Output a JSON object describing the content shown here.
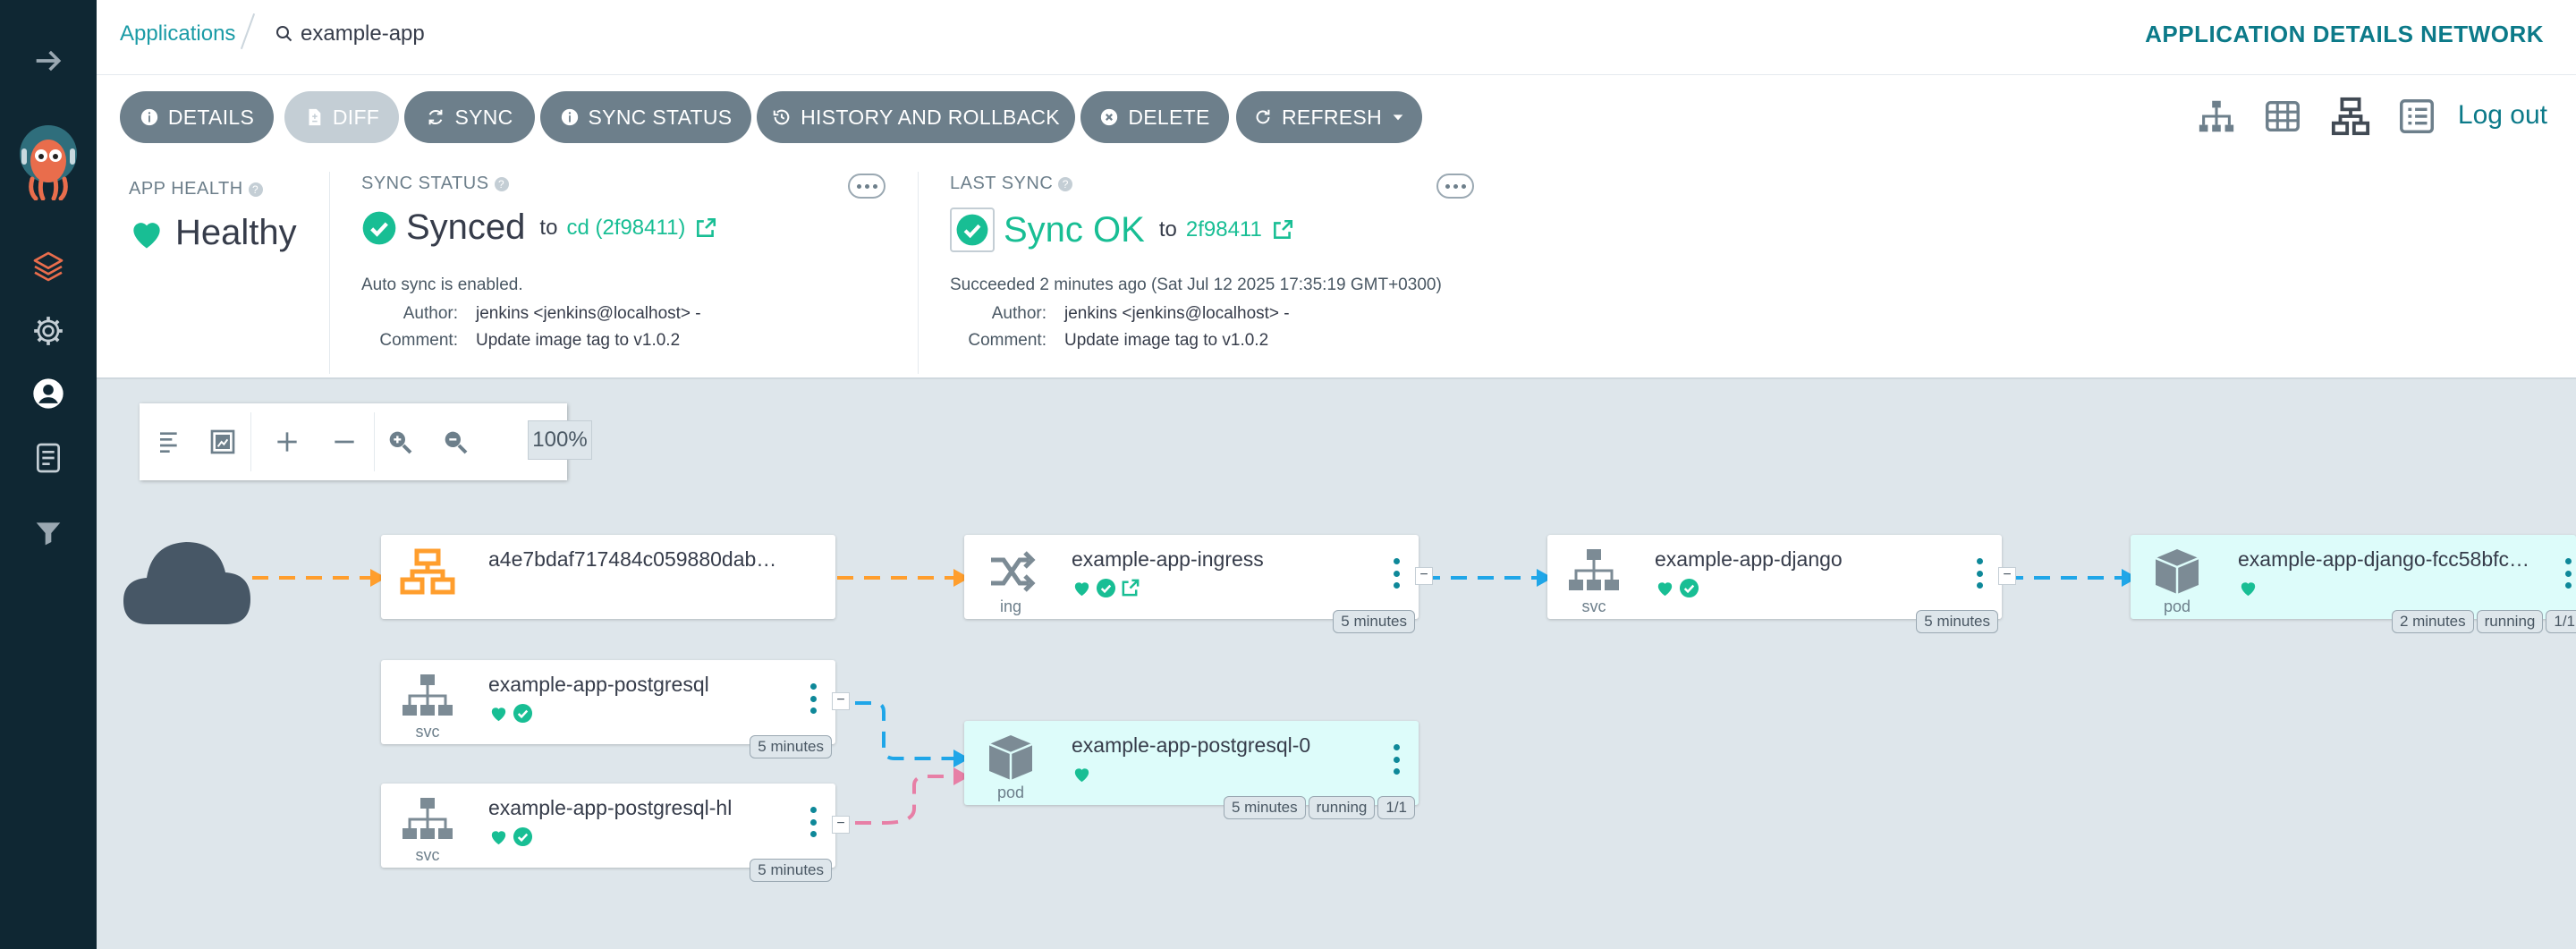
{
  "breadcrumb": {
    "applications": "Applications",
    "current": "example-app"
  },
  "page_title": "APPLICATION DETAILS NETWORK",
  "toolbar": {
    "details": "DETAILS",
    "diff": "DIFF",
    "sync": "SYNC",
    "sync_status": "SYNC STATUS",
    "history": "HISTORY AND ROLLBACK",
    "delete": "DELETE",
    "refresh": "REFRESH",
    "logout": "Log out"
  },
  "app_health": {
    "label": "APP HEALTH",
    "value": "Healthy",
    "help": "?"
  },
  "sync_status": {
    "label": "SYNC STATUS",
    "help": "?",
    "value": "Synced",
    "to": "to",
    "revision": "cd (2f98411)",
    "auto_sync": "Auto sync is enabled.",
    "author_key": "Author:",
    "author": "jenkins <jenkins@localhost> -",
    "comment_key": "Comment:",
    "comment": "Update image tag to v1.0.2"
  },
  "last_sync": {
    "label": "LAST SYNC",
    "help": "?",
    "value": "Sync OK",
    "to": "to",
    "revision": "2f98411",
    "succeeded": "Succeeded 2 minutes ago (Sat Jul 12 2025 17:35:19 GMT+0300)",
    "author_key": "Author:",
    "author": "jenkins <jenkins@localhost> -",
    "comment_key": "Comment:",
    "comment": "Update image tag to v1.0.2"
  },
  "zoom": {
    "value": "100%"
  },
  "nodes": {
    "lb": {
      "name": "a4e7bdaf717484c059880dab…"
    },
    "ingress": {
      "name": "example-app-ingress",
      "kind": "ing",
      "age": "5 minutes"
    },
    "svc_django": {
      "name": "example-app-django",
      "kind": "svc",
      "age": "5 minutes"
    },
    "pod_django": {
      "name": "example-app-django-fcc58bfc…",
      "kind": "pod",
      "age": "2 minutes",
      "status": "running",
      "ready": "1/1"
    },
    "svc_pg": {
      "name": "example-app-postgresql",
      "kind": "svc",
      "age": "5 minutes"
    },
    "svc_pg_hl": {
      "name": "example-app-postgresql-hl",
      "kind": "svc",
      "age": "5 minutes"
    },
    "pod_pg": {
      "name": "example-app-postgresql-0",
      "kind": "pod",
      "age": "5 minutes",
      "status": "running",
      "ready": "1/1"
    }
  },
  "collapse_symbol": "−",
  "colors": {
    "accent": "#18be94",
    "teal": "#0c7a89",
    "nav": "#0f2733",
    "edge_orange": "#ff9e2d",
    "edge_blue": "#1fa6e8",
    "edge_pink": "#e77fa6"
  }
}
